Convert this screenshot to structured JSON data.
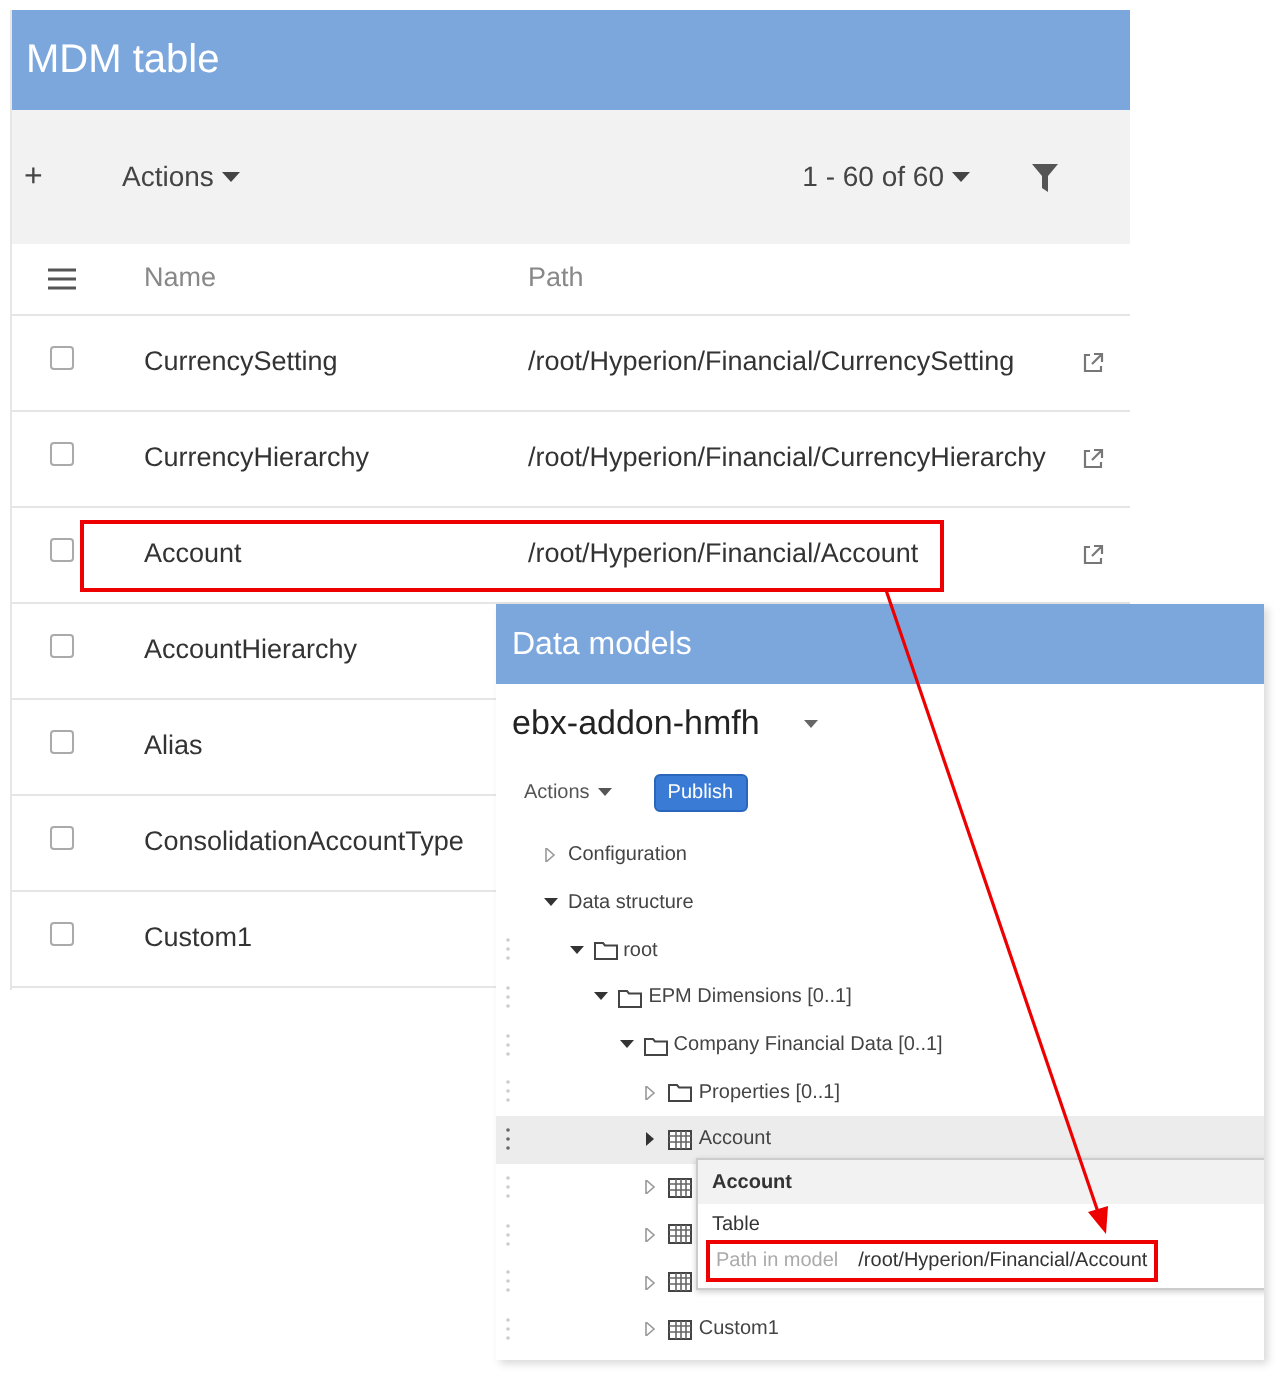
{
  "main_window": {
    "title": "MDM table",
    "toolbar": {
      "add": "+",
      "actions": "Actions",
      "pagination": "1 - 60 of 60"
    },
    "table": {
      "columns": [
        "Name",
        "Path"
      ],
      "rows": [
        {
          "name": "CurrencySetting",
          "path": "/root/Hyperion/Financial/CurrencySetting",
          "checked": false,
          "highlighted": false
        },
        {
          "name": "CurrencyHierarchy",
          "path": "/root/Hyperion/Financial/CurrencyHierarchy",
          "checked": false,
          "highlighted": false
        },
        {
          "name": "Account",
          "path": "/root/Hyperion/Financial/Account",
          "checked": false,
          "highlighted": true
        },
        {
          "name": "AccountHierarchy",
          "checked": false,
          "highlighted": false
        },
        {
          "name": "Alias",
          "checked": false,
          "highlighted": false
        },
        {
          "name": "ConsolidationAccountType",
          "checked": false,
          "highlighted": false
        },
        {
          "name": "Custom1",
          "checked": false,
          "highlighted": false
        }
      ]
    }
  },
  "data_models_window": {
    "title": "Data models",
    "model": "ebx-addon-hmfh",
    "actions": "Actions",
    "publish": "Publish",
    "tree": [
      {
        "label": "Configuration",
        "expanded": false,
        "selected": false
      },
      {
        "label": "Data structure",
        "expanded": true,
        "selected": false,
        "children": [
          {
            "label": "root",
            "kind": "folder",
            "expanded": true,
            "selected": false,
            "children": [
              {
                "label": "EPM Dimensions [0..1]",
                "kind": "folder",
                "expanded": true,
                "selected": false,
                "children": [
                  {
                    "label": "Company Financial Data [0..1]",
                    "kind": "folder",
                    "expanded": true,
                    "selected": false,
                    "children": [
                      {
                        "label": "Properties [0..1]",
                        "kind": "folder",
                        "expanded": false,
                        "selected": false
                      },
                      {
                        "label": "Account",
                        "kind": "table",
                        "expanded": false,
                        "selected": true
                      },
                      {
                        "kind": "table",
                        "expanded": false,
                        "selected": false
                      },
                      {
                        "kind": "table",
                        "expanded": false,
                        "selected": false
                      },
                      {
                        "kind": "table",
                        "expanded": false,
                        "selected": false
                      },
                      {
                        "label": "Custom1",
                        "kind": "table",
                        "expanded": false,
                        "selected": false
                      }
                    ]
                  }
                ]
              }
            ]
          }
        ]
      }
    ],
    "popup": {
      "title": "Account",
      "type": "Table",
      "path_label": "Path in model",
      "path": "/root/Hyperion/Financial/Account",
      "highlighted": true
    }
  }
}
